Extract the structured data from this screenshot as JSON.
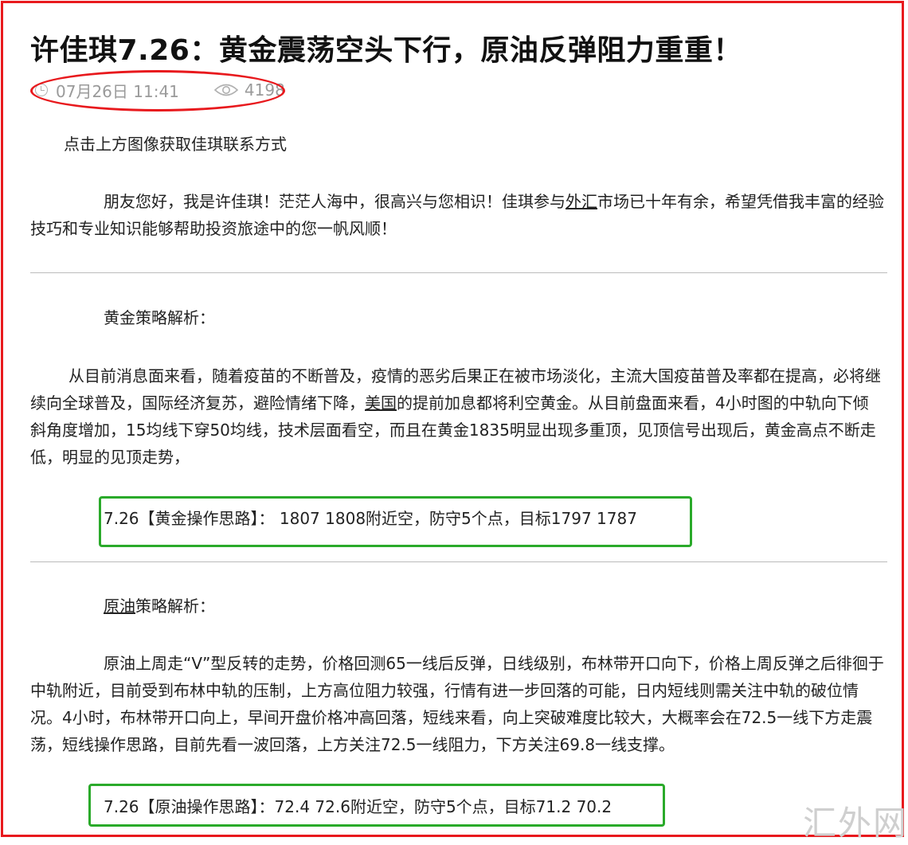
{
  "article": {
    "title": "许佳琪7.26：黄金震荡空头下行，原油反弹阻力重重！",
    "date": "07月26日 11:41",
    "views": "4198"
  },
  "intro": {
    "contact_hint": "点击上方图像获取佳琪联系方式",
    "greeting_before": "朋友您好，我是许佳琪！茫茫人海中，很高兴与您相识！佳琪参与",
    "greeting_link": "外汇",
    "greeting_after": "市场已十年有余，希望凭借我丰富的经验技巧和专业知识能够帮助投资旅途中的您一帆风顺！"
  },
  "gold": {
    "heading": "黄金策略解析：",
    "analysis_before": "从目前消息面来看，随着疫苗的不断普及，疫情的恶劣后果正在被市场淡化，主流大国疫苗普及率都在提高，必将继续向全球普及，国际经济复苏，避险情绪下降，",
    "analysis_link": "美国",
    "analysis_after": "的提前加息都将利空黄金。从目前盘面来看，4小时图的中轨向下倾斜角度增加，15均线下穿50均线，技术层面看空，而且在黄金1835明显出现多重顶，见顶信号出现后，黄金高点不断走低，明显的见顶走势，",
    "strategy": "7.26【黄金操作思路】： 1807 1808附近空，防守5个点，目标1797   1787"
  },
  "oil": {
    "heading_link": "原油",
    "heading_rest": "策略解析：",
    "analysis": "原油上周走“V”型反转的走势，价格回测65一线后反弹，日线级别，布林带开口向下，价格上周反弹之后徘徊于中轨附近，目前受到布林中轨的压制，上方高位阻力较强，行情有进一步回落的可能，日内短线则需关注中轨的破位情况。4小时，布林带开口向上，早间开盘价格冲高回落，短线来看，向上突破难度比较大，大概率会在72.5一线下方走震荡，短线操作思路，目前先看一波回落，上方关注72.5一线阻力，下方关注69.8一线支撑。",
    "strategy": "7.26【原油操作思路】：72.4  72.6附近空，防守5个点，目标71.2  70.2"
  },
  "watermark": "汇外网",
  "colors": {
    "annotation_red": "#e8191d",
    "annotation_green": "#2aaa2a",
    "meta_gray": "#9a9a9a"
  },
  "icons": [
    "clock-icon",
    "eye-icon"
  ]
}
